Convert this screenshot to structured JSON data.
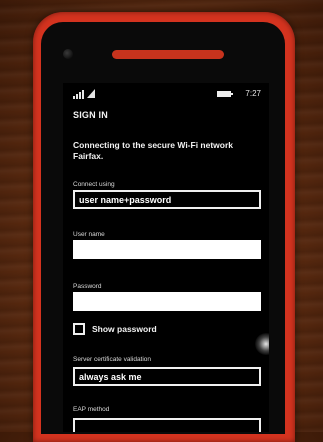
{
  "status": {
    "time": "7:27"
  },
  "page": {
    "title": "SIGN IN"
  },
  "intro": "Connecting to the secure Wi-Fi network Fairfax.",
  "connect_using": {
    "label": "Connect using",
    "value": "user name+password"
  },
  "user_name": {
    "label": "User name",
    "value": ""
  },
  "password": {
    "label": "Password",
    "value": ""
  },
  "show_password": {
    "label": "Show password",
    "checked": false
  },
  "server_cert": {
    "label": "Server certificate validation",
    "value": "always ask me"
  },
  "eap_method": {
    "label": "EAP method"
  },
  "icons": [
    "signal-icon",
    "wifi-icon",
    "battery-icon"
  ]
}
